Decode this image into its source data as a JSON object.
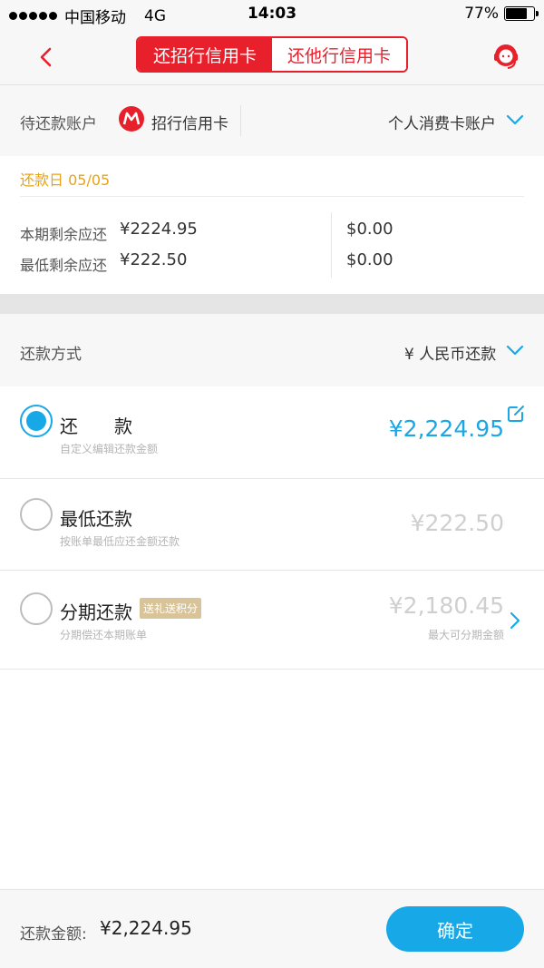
{
  "status_bar": {
    "carrier": "中国移动",
    "network": "4G",
    "time": "14:03",
    "battery": "77%",
    "battery_level": 0.77
  },
  "nav": {
    "tabs": [
      {
        "label": "还招行信用卡",
        "active": true
      },
      {
        "label": "还他行信用卡",
        "active": false
      }
    ]
  },
  "account": {
    "label": "待还款账户",
    "bank": "招行信用卡",
    "account_type": "个人消费卡账户"
  },
  "due": {
    "date_label": "还款日 05/05",
    "remaining_label": "本期剩余应还",
    "remaining_cny": "¥2224.95",
    "remaining_usd": "$0.00",
    "min_label": "最低剩余应还",
    "min_cny": "¥222.50",
    "min_usd": "$0.00"
  },
  "method": {
    "label": "还款方式",
    "value": "¥ 人民币还款"
  },
  "options": [
    {
      "title": "还　　款",
      "subtitle": "自定义编辑还款金额",
      "amount": "¥2,224.95",
      "selected": true
    },
    {
      "title": "最低还款",
      "subtitle": "按账单最低应还金额还款",
      "amount": "¥222.50",
      "selected": false
    },
    {
      "title": "分期还款",
      "subtitle": "分期偿还本期账单",
      "amount": "¥2,180.45",
      "badge": "送礼送积分",
      "note": "最大可分期金额",
      "selected": false
    }
  ],
  "footer": {
    "label": "还款金额:",
    "amount": "¥2,224.95",
    "confirm": "确定"
  },
  "colors": {
    "brand_red": "#e8202c",
    "accent_blue": "#17a8e8",
    "due_date_orange": "#e8a317"
  }
}
